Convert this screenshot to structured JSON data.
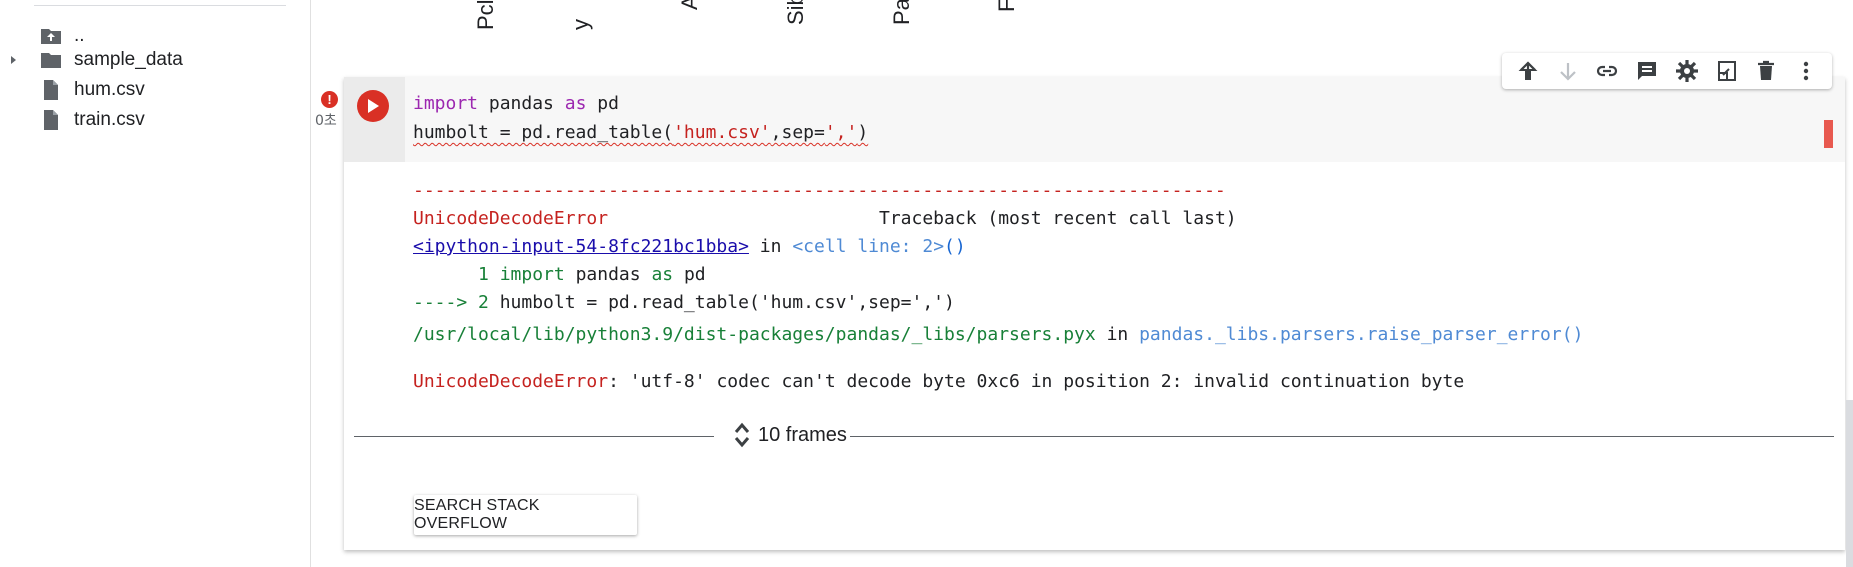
{
  "file_panel": {
    "items": [
      {
        "name": "..",
        "icon": "folder-up-icon",
        "expandable": false
      },
      {
        "name": "sample_data",
        "icon": "folder-icon",
        "expandable": true
      },
      {
        "name": "hum.csv",
        "icon": "file-icon",
        "expandable": false
      },
      {
        "name": "train.csv",
        "icon": "file-icon",
        "expandable": false
      }
    ]
  },
  "previous_output": {
    "column_labels": [
      "Pcla",
      "y",
      "A",
      "Sib",
      "Pa",
      "F"
    ]
  },
  "toolbar": {
    "buttons": [
      "move-up-icon",
      "move-down-icon",
      "link-icon",
      "comment-icon",
      "settings-icon",
      "mirror-cell-icon",
      "delete-icon",
      "more-icon"
    ]
  },
  "cell": {
    "status": "error",
    "error_badge": "!",
    "exec_time": "0초",
    "code": {
      "line1": {
        "kw1": "import",
        "mid": " pandas ",
        "kw2": "as",
        "end": " pd"
      },
      "line2": {
        "pre": "humbolt = pd.read_table(",
        "str1": "'hum.csv'",
        "mid": ",sep=",
        "str2": "','",
        "post": ")"
      }
    }
  },
  "output": {
    "dashes": "---------------------------------------------------------------------------",
    "error_name": "UnicodeDecodeError",
    "traceback_label": "                         Traceback (most recent call last)",
    "input_link": "<ipython-input-54-8fc221bc1bba>",
    "in_word": " in ",
    "cell_line": "<cell line: 2>",
    "cell_line_suffix": "()",
    "tb_line1_num": "      1 ",
    "tb_line1_code": {
      "kw1": "import",
      "mid": " pandas ",
      "kw2": "as",
      "end": " pd"
    },
    "tb_line2_arrow": "----> 2 ",
    "tb_line2_code": "humbolt = pd.read_table('hum.csv',sep=',')",
    "frames_label": "10 frames",
    "path": "/usr/local/lib/python3.9/dist-packages/pandas/_libs/parsers.pyx",
    "path_in": " in ",
    "func": "pandas._libs.parsers.raise_parser_error()",
    "final_error_name": "UnicodeDecodeError",
    "final_error_msg": ": 'utf-8' codec can't decode byte 0xc6 in position 2: invalid continuation byte",
    "search_button": "SEARCH STACK OVERFLOW"
  },
  "colors": {
    "error_red": "#d93025",
    "keyword": "#9c27b0",
    "string": "#c5221f",
    "path_green": "#188038"
  }
}
